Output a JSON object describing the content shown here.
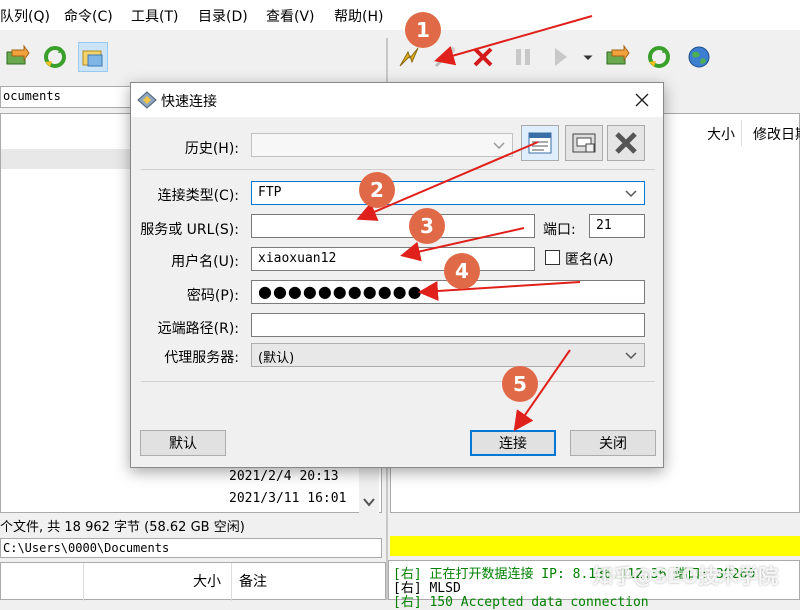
{
  "menubar": {
    "items": [
      "队列(Q)",
      "命令(C)",
      "工具(T)",
      "目录(D)",
      "查看(V)",
      "帮助(H)"
    ]
  },
  "toolbar": {
    "icons": [
      "connect-icon",
      "reconnect-icon",
      "disconnect-icon",
      "abort-icon",
      "pause-icon",
      "skip-icon",
      "refresh-icon",
      "sync-icon",
      "globe-icon"
    ]
  },
  "local_pane": {
    "path": "ocuments",
    "rows": [
      {
        "date": "2021/2/4 20:13"
      },
      {
        "date": "2021/3/11 16:01"
      }
    ],
    "status": "个文件, 共 18 962 字节 (58.62 GB 空闲)",
    "path_bottom": "C:\\Users\\0000\\Documents"
  },
  "remote_pane": {
    "col_size": "大小",
    "col_modified": "修改日期"
  },
  "queue_pane": {
    "col_size": "大小",
    "col_note": "备注"
  },
  "log": {
    "lines": [
      {
        "text": "[右] 正在打开数据连接 IP: 8.136.112.36 端口: 39260",
        "color": "#008000"
      },
      {
        "text": "[右] MLSD",
        "color": "#000000"
      },
      {
        "text": "[右] 150 Accepted data connection",
        "color": "#008000"
      }
    ]
  },
  "watermark": "知乎@SEO技术学院",
  "dialog": {
    "title": "快速连接",
    "history_label": "历史(H):",
    "conn_type_label": "连接类型(C):",
    "conn_type_value": "FTP",
    "server_label": "服务或 URL(S):",
    "server_value": "",
    "port_label": "端口:",
    "port_value": "21",
    "user_label": "用户名(U):",
    "user_value": "xiaoxuan12",
    "anon_label": "匿名(A)",
    "pass_label": "密码(P):",
    "pass_value": "●●●●●●●●●●●",
    "remote_path_label": "远端路径(R):",
    "remote_path_value": "",
    "proxy_label": "代理服务器:",
    "proxy_value": "(默认)",
    "default_btn": "默认",
    "connect_btn": "连接",
    "close_btn": "关闭"
  },
  "annotations": [
    "1",
    "2",
    "3",
    "4",
    "5"
  ],
  "colors": {
    "accent": "#0078d7",
    "badge": "#e06a47",
    "arrow": "#e0201a",
    "status_yellow": "#ffff00",
    "log_green": "#008000"
  }
}
